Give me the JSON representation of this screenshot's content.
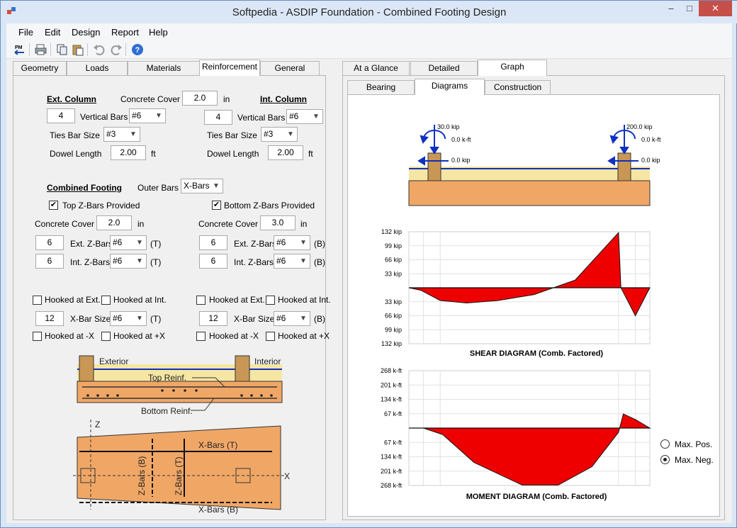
{
  "window": {
    "title": "Softpedia - ASDIP Foundation - Combined Footing Design"
  },
  "menu": [
    "File",
    "Edit",
    "Design",
    "Report",
    "Help"
  ],
  "toolbar": {
    "pm_label": "PM"
  },
  "left_tabs": [
    "Geometry",
    "Loads",
    "Materials",
    "Reinforcement",
    "General"
  ],
  "left_active": "Reinforcement",
  "right_tabs": [
    "At a Glance",
    "Detailed",
    "Graph"
  ],
  "right_active": "Graph",
  "graph_tabs": [
    "Bearing",
    "Diagrams",
    "Construction"
  ],
  "graph_active": "Diagrams",
  "ext_col": {
    "heading": "Ext. Column",
    "cover_label": "Concrete Cover",
    "cover": "2.0",
    "cover_unit": "in",
    "vbars_count": "4",
    "vbars_label": "Vertical Bars",
    "vbars_size": "#6",
    "ties_label": "Ties Bar Size",
    "ties_size": "#3",
    "dowel_label": "Dowel Length",
    "dowel": "2.00",
    "dowel_unit": "ft"
  },
  "int_col": {
    "heading": "Int. Column",
    "vbars_count": "4",
    "vbars_label": "Vertical Bars",
    "vbars_size": "#6",
    "ties_label": "Ties Bar Size",
    "ties_size": "#3",
    "dowel_label": "Dowel Length",
    "dowel": "2.00",
    "dowel_unit": "ft"
  },
  "footing": {
    "heading": "Combined Footing",
    "outer_label": "Outer Bars",
    "outer": "X-Bars",
    "top_label": "Top Z-Bars Provided",
    "top_checked": true,
    "bottom_label": "Bottom Z-Bars Provided",
    "bottom_checked": true,
    "top": {
      "cover_label": "Concrete Cover",
      "cover": "2.0",
      "cover_unit": "in",
      "ext_count": "6",
      "ext_label": "Ext. Z-Bars",
      "ext_size": "#6",
      "ext_tag": "(T)",
      "int_count": "6",
      "int_label": "Int. Z-Bars",
      "int_size": "#6",
      "int_tag": "(T)",
      "hook_ext": "Hooked at Ext.",
      "hook_int": "Hooked at Int.",
      "x_count": "12",
      "x_label": "X-Bar Size",
      "x_size": "#6",
      "x_tag": "(T)",
      "hook_mx": "Hooked at -X",
      "hook_px": "Hooked at +X"
    },
    "bottom": {
      "cover_label": "Concrete Cover",
      "cover": "3.0",
      "cover_unit": "in",
      "ext_count": "6",
      "ext_label": "Ext. Z-Bars",
      "ext_size": "#6",
      "ext_tag": "(B)",
      "int_count": "6",
      "int_label": "Int. Z-Bars",
      "int_size": "#6",
      "int_tag": "(B)",
      "hook_ext": "Hooked at Ext.",
      "hook_int": "Hooked at Int.",
      "x_count": "12",
      "x_label": "X-Bar Size",
      "x_size": "#6",
      "x_tag": "(B)",
      "hook_mx": "Hooked at -X",
      "hook_px": "Hooked at +X"
    }
  },
  "section_sketch": {
    "exterior": "Exterior",
    "interior": "Interior",
    "top_reinf": "Top Reinf.",
    "bottom_reinf": "Bottom Reinf."
  },
  "plan_sketch": {
    "z": "Z",
    "x": "X",
    "xbars_t": "X-Bars (T)",
    "xbars_b": "X-Bars (B)",
    "zbars_b": "Z-Bars (B)",
    "zbars_t": "Z-Bars (T)"
  },
  "loads": {
    "ext_p": "30.0 kip",
    "ext_m": "0.0 k-ft",
    "ext_h": "0.0 kip",
    "int_p": "200.0 kip",
    "int_m": "0.0 k-ft",
    "int_h": "0.0 kip"
  },
  "shear": {
    "title": "SHEAR DIAGRAM (Comb. Factored)",
    "ticks_pos": [
      "132 kip",
      "99 kip",
      "66 kip",
      "33 kip"
    ],
    "ticks_neg": [
      "33 kip",
      "66 kip",
      "99 kip",
      "132 kip"
    ],
    "x": [
      0,
      0.05,
      0.13,
      0.24,
      0.37,
      0.52,
      0.69,
      0.87,
      0.88,
      0.94,
      1.0
    ],
    "y": [
      0,
      -6,
      -30,
      -36,
      -30,
      -16,
      18,
      130,
      0,
      -66,
      0
    ]
  },
  "moment": {
    "title": "MOMENT DIAGRAM (Comb. Factored)",
    "ticks_pos": [
      "268 k-ft",
      "201 k-ft",
      "134 k-ft",
      "67 k-ft"
    ],
    "ticks_neg": [
      "67 k-ft",
      "134 k-ft",
      "201 k-ft",
      "268 k-ft"
    ],
    "x": [
      0,
      0.06,
      0.14,
      0.27,
      0.47,
      0.62,
      0.76,
      0.87,
      0.89,
      0.94,
      1.0
    ],
    "y": [
      0,
      0,
      -30,
      -160,
      -266,
      -266,
      -180,
      -20,
      66,
      40,
      0
    ],
    "opt_pos": "Max. Pos.",
    "opt_neg": "Max. Neg.",
    "selected": "neg"
  }
}
